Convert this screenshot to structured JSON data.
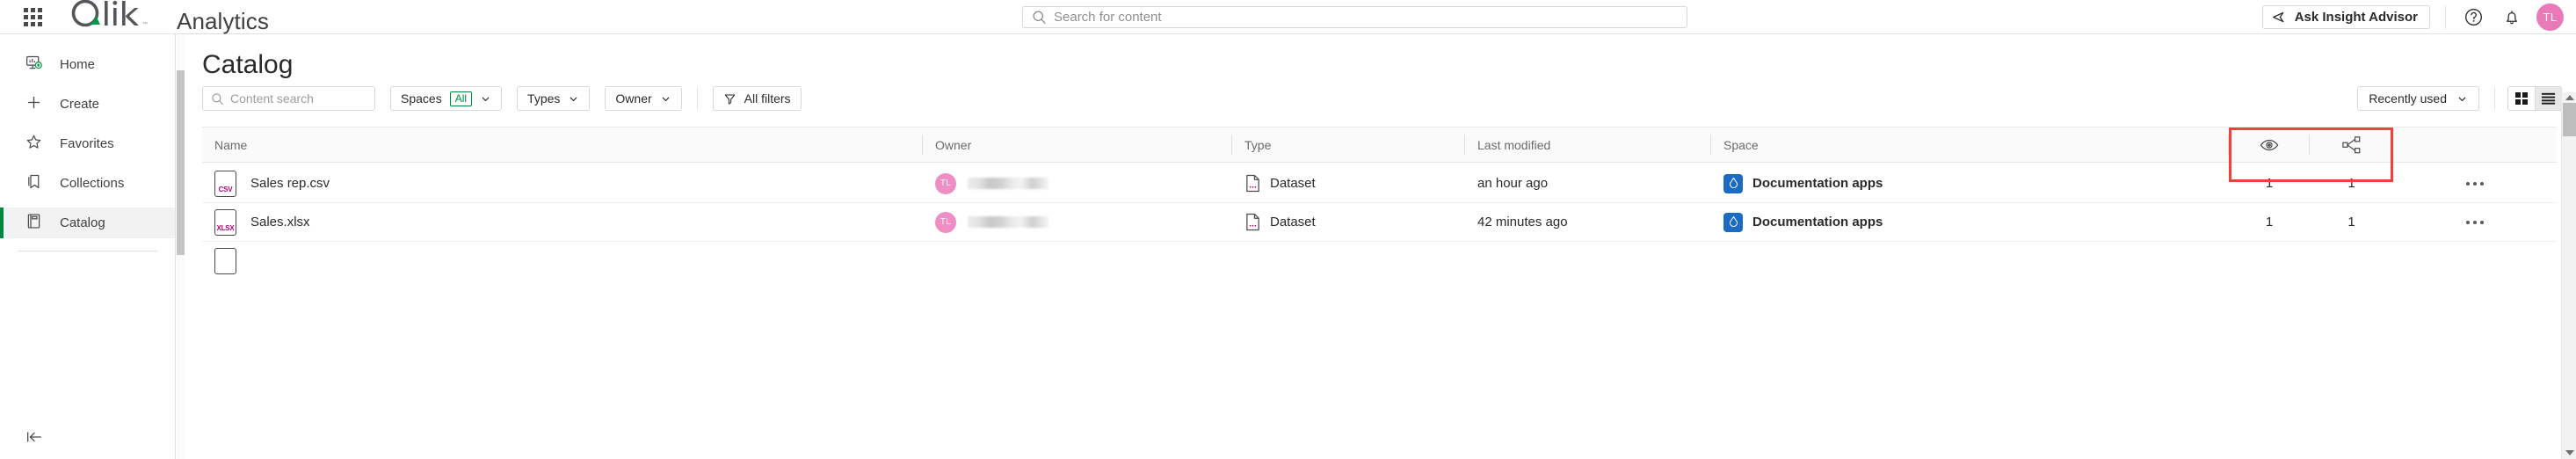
{
  "header": {
    "app_name": "Analytics",
    "logo_text": "Qlik",
    "search_placeholder": "Search for content",
    "search_value": "",
    "insight_advisor_label": "Ask Insight Advisor",
    "avatar_initials": "TL",
    "icons": {
      "waffle": "app-launcher-icon",
      "search": "search-icon",
      "help": "help-circle-icon",
      "notifications": "bell-icon"
    },
    "colors": {
      "logo_green": "#00873d",
      "avatar_pink": "#e87ab8"
    }
  },
  "sidebar": {
    "items": [
      {
        "label": "Home",
        "icon": "home-chart-icon",
        "active": false
      },
      {
        "label": "Create",
        "icon": "plus-icon",
        "active": false
      },
      {
        "label": "Favorites",
        "icon": "star-icon",
        "active": false
      },
      {
        "label": "Collections",
        "icon": "bookmark-icon",
        "active": false
      },
      {
        "label": "Catalog",
        "icon": "book-icon",
        "active": true
      }
    ],
    "collapse_label": "collapse-sidebar",
    "active_accent": "#00873d"
  },
  "main": {
    "page_title": "Catalog",
    "toolbar": {
      "content_search_placeholder": "Content search",
      "content_search_value": "",
      "spaces_label": "Spaces",
      "spaces_badge": "All",
      "types_label": "Types",
      "owner_label": "Owner",
      "all_filters_label": "All filters",
      "sort_label": "Recently used",
      "view_grid": "grid-view",
      "view_list": "list-view",
      "active_view": "list"
    },
    "table": {
      "columns": [
        {
          "label": "Name",
          "key": "name"
        },
        {
          "label": "Owner",
          "key": "owner"
        },
        {
          "label": "Type",
          "key": "type"
        },
        {
          "label": "Last modified",
          "key": "last_modified"
        },
        {
          "label": "Space",
          "key": "space"
        },
        {
          "label": "",
          "key": "views",
          "icon": "eye-icon"
        },
        {
          "label": "",
          "key": "lineage",
          "icon": "lineage-icon"
        },
        {
          "label": "",
          "key": "actions"
        }
      ],
      "rows": [
        {
          "name": "Sales rep.csv",
          "file_ext": "CSV",
          "owner_initials": "TL",
          "owner_name_redacted": true,
          "type": "Dataset",
          "last_modified": "an hour ago",
          "space": "Documentation apps",
          "views": "1",
          "lineage": "1"
        },
        {
          "name": "Sales.xlsx",
          "file_ext": "XLSX",
          "owner_initials": "TL",
          "owner_name_redacted": true,
          "type": "Dataset",
          "last_modified": "42 minutes ago",
          "space": "Documentation apps",
          "views": "1",
          "lineage": "1"
        }
      ]
    },
    "highlight": {
      "color": "#f0423c",
      "target": "views-and-lineage-columns"
    }
  }
}
